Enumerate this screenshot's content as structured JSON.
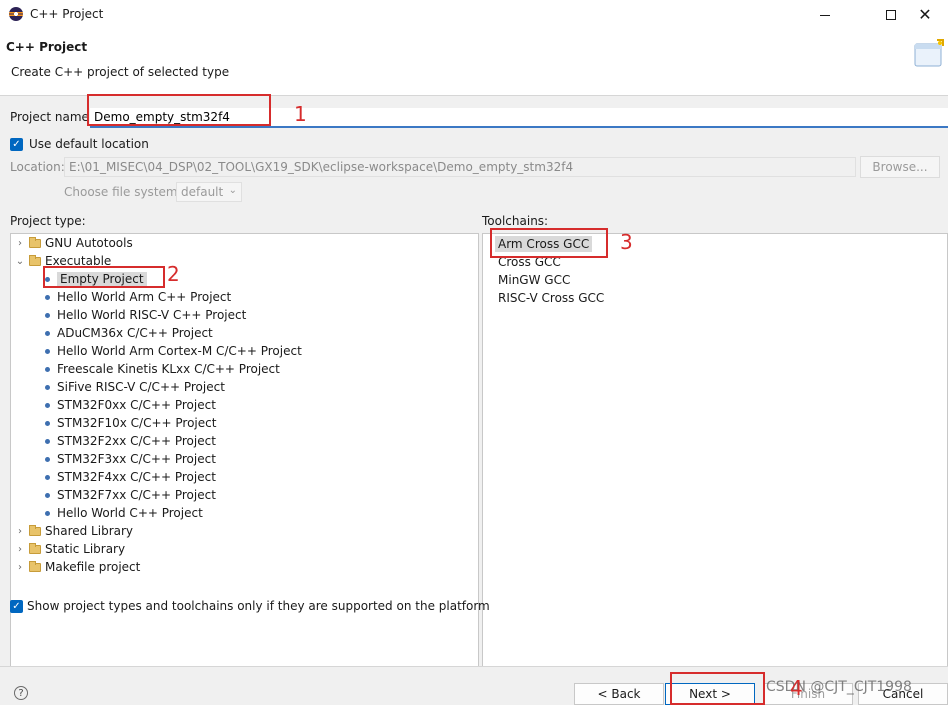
{
  "window": {
    "title": "C++ Project",
    "icon": "eclipse-icon"
  },
  "header": {
    "title": "C++ Project",
    "description": "Create C++ project of selected type",
    "icon": "new-project-wizard-icon"
  },
  "form": {
    "project_name_label": "Project name:",
    "project_name_value": "Demo_empty_stm32f4",
    "use_default_location_label": "Use default location",
    "use_default_location_checked": true,
    "location_label": "Location:",
    "location_value": "E:\\01_MISEC\\04_DSP\\02_TOOL\\GX19_SDK\\eclipse-workspace\\Demo_empty_stm32f4",
    "browse_label": "Browse...",
    "file_system_label": "Choose file system:",
    "file_system_value": "default"
  },
  "project_type": {
    "label": "Project type:",
    "items": [
      {
        "label": "GNU Autotools",
        "kind": "folder",
        "expanded": false
      },
      {
        "label": "Executable",
        "kind": "folder",
        "expanded": true
      },
      {
        "label": "Empty Project",
        "kind": "item",
        "selected": true
      },
      {
        "label": "Hello World Arm C++ Project",
        "kind": "item"
      },
      {
        "label": "Hello World RISC-V C++ Project",
        "kind": "item"
      },
      {
        "label": "ADuCM36x C/C++ Project",
        "kind": "item"
      },
      {
        "label": "Hello World Arm Cortex-M C/C++ Project",
        "kind": "item"
      },
      {
        "label": "Freescale Kinetis KLxx C/C++ Project",
        "kind": "item"
      },
      {
        "label": "SiFive RISC-V C/C++ Project",
        "kind": "item"
      },
      {
        "label": "STM32F0xx C/C++ Project",
        "kind": "item"
      },
      {
        "label": "STM32F10x C/C++ Project",
        "kind": "item"
      },
      {
        "label": "STM32F2xx C/C++ Project",
        "kind": "item"
      },
      {
        "label": "STM32F3xx C/C++ Project",
        "kind": "item"
      },
      {
        "label": "STM32F4xx C/C++ Project",
        "kind": "item"
      },
      {
        "label": "STM32F7xx C/C++ Project",
        "kind": "item"
      },
      {
        "label": "Hello World C++ Project",
        "kind": "item"
      },
      {
        "label": "Shared Library",
        "kind": "folder",
        "expanded": false
      },
      {
        "label": "Static Library",
        "kind": "folder",
        "expanded": false
      },
      {
        "label": "Makefile project",
        "kind": "folder",
        "expanded": false
      }
    ]
  },
  "toolchains": {
    "label": "Toolchains:",
    "items": [
      {
        "label": "Arm Cross GCC",
        "selected": true
      },
      {
        "label": "Cross GCC"
      },
      {
        "label": "MinGW GCC"
      },
      {
        "label": "RISC-V Cross GCC"
      }
    ]
  },
  "show_supported": {
    "label": "Show project types and toolchains only if they are supported on the platform",
    "checked": true
  },
  "footer": {
    "back_label": "< Back",
    "next_label": "Next >",
    "finish_label": "Finish",
    "cancel_label": "Cancel"
  },
  "annotations": [
    "1",
    "2",
    "3",
    "4"
  ],
  "watermark": "CSDN @CJT_CJT1998",
  "colors": {
    "accent": "#0067c0",
    "annotation": "#d62c2c",
    "selection": "#d9d9d9"
  }
}
